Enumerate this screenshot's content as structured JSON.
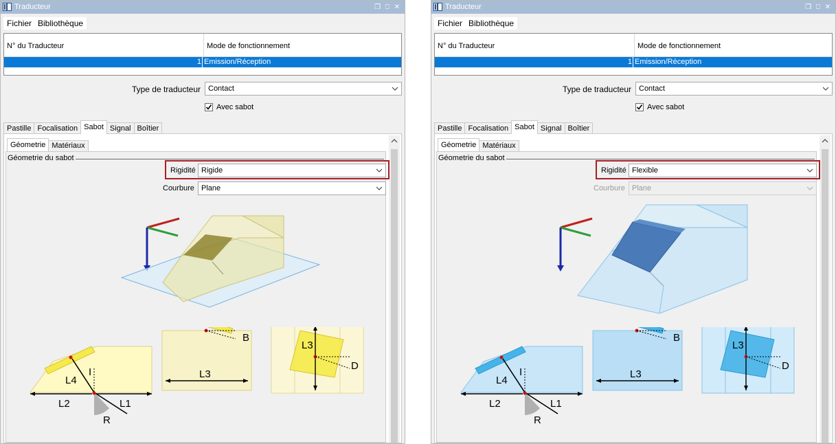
{
  "panels": [
    {
      "title": "Traducteur",
      "window_controls": "❒ ⎕ ✕",
      "menu": [
        "Fichier",
        "Bibliothèque"
      ],
      "grid": {
        "columns": [
          "N° du Traducteur",
          "Mode de fonctionnement"
        ],
        "rows": [
          {
            "num": "1",
            "mode": "Emission/Réception"
          }
        ]
      },
      "type_label": "Type de traducteur",
      "type_value": "Contact",
      "checkbox_label": "Avec sabot",
      "checkbox_checked": true,
      "tabs": [
        "Pastille",
        "Focalisation",
        "Sabot",
        "Signal",
        "Boîtier"
      ],
      "active_tab": "Sabot",
      "subtabs": [
        "Géometrie",
        "Matériaux"
      ],
      "group_title": "Géometrie du sabot",
      "rigidite_label": "Rigidité",
      "rigidite_value": "Rigide",
      "courbure_label": "Courbure",
      "courbure_value": "Plane",
      "courbure_disabled": false,
      "theme": "yellow"
    },
    {
      "title": "Traducteur",
      "window_controls": "❒ ⎕ ✕",
      "menu": [
        "Fichier",
        "Bibliothèque"
      ],
      "grid": {
        "columns": [
          "N° du Traducteur",
          "Mode de fonctionnement"
        ],
        "rows": [
          {
            "num": "1",
            "mode": "Emission/Réception"
          }
        ]
      },
      "type_label": "Type de traducteur",
      "type_value": "Contact",
      "checkbox_label": "Avec sabot",
      "checkbox_checked": true,
      "tabs": [
        "Pastille",
        "Focalisation",
        "Sabot",
        "Signal",
        "Boîtier"
      ],
      "active_tab": "Sabot",
      "subtabs": [
        "Géometrie",
        "Matériaux"
      ],
      "group_title": "Géometrie du sabot",
      "rigidite_label": "Rigidité",
      "rigidite_value": "Flexible",
      "courbure_label": "Courbure",
      "courbure_value": "Plane",
      "courbure_disabled": true,
      "theme": "blue"
    }
  ],
  "diagram_labels": {
    "wedge": [
      "L4",
      "I",
      "L2",
      "L1",
      "R"
    ],
    "top_view": [
      "B",
      "L3"
    ],
    "side_view": [
      "L3",
      "D"
    ]
  },
  "colors": {
    "selection": "#0a7ad6",
    "highlight_box": "#a81f24",
    "titlebar": "#a7bdd6",
    "yellow_fill": "#fff9c4",
    "yellow_stroke": "#d9d28a",
    "blue_fill": "#c8e6f8",
    "blue_stroke": "#8cc2e6"
  },
  "icons": [
    "app-window-icon",
    "combo-arrow-icon",
    "checkmark-icon",
    "scroll-up-icon",
    "axes-triad-icon"
  ]
}
